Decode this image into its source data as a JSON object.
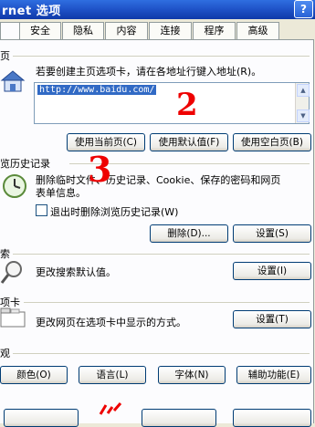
{
  "window": {
    "title": "rnet 选项",
    "help_label": "?"
  },
  "tabs": [
    {
      "label": "安全"
    },
    {
      "label": "隐私"
    },
    {
      "label": "内容"
    },
    {
      "label": "连接"
    },
    {
      "label": "程序"
    },
    {
      "label": "高级"
    }
  ],
  "home": {
    "group_label": "页",
    "instruction": "若要创建主页选项卡，请在各地址行键入地址(R)。",
    "url_value": "http://www.baidu.com/",
    "buttons": {
      "use_current": "使用当前页(C)",
      "use_default": "使用默认值(F)",
      "use_blank": "使用空白页(B)"
    }
  },
  "history": {
    "group_label": "览历史记录",
    "description_line1": "删除临时文件、历史记录、Cookie、保存的密码和网页",
    "description_line2": "表单信息。",
    "checkbox_label": "退出时删除浏览历史记录(W)",
    "buttons": {
      "delete": "删除(D)...",
      "settings": "设置(S)"
    }
  },
  "search": {
    "group_label": "索",
    "description": "更改搜索默认值。",
    "settings_label": "设置(I)"
  },
  "tabs_group": {
    "group_label": "项卡",
    "description": "更改网页在选项卡中显示的方式。",
    "settings_label": "设置(T)"
  },
  "appearance": {
    "group_label": "观",
    "buttons": {
      "colors": "颜色(O)",
      "languages": "语言(L)",
      "fonts": "字体(N)",
      "accessibility": "辅助功能(E)"
    }
  },
  "annotations": {
    "two": "2",
    "three": "3"
  }
}
